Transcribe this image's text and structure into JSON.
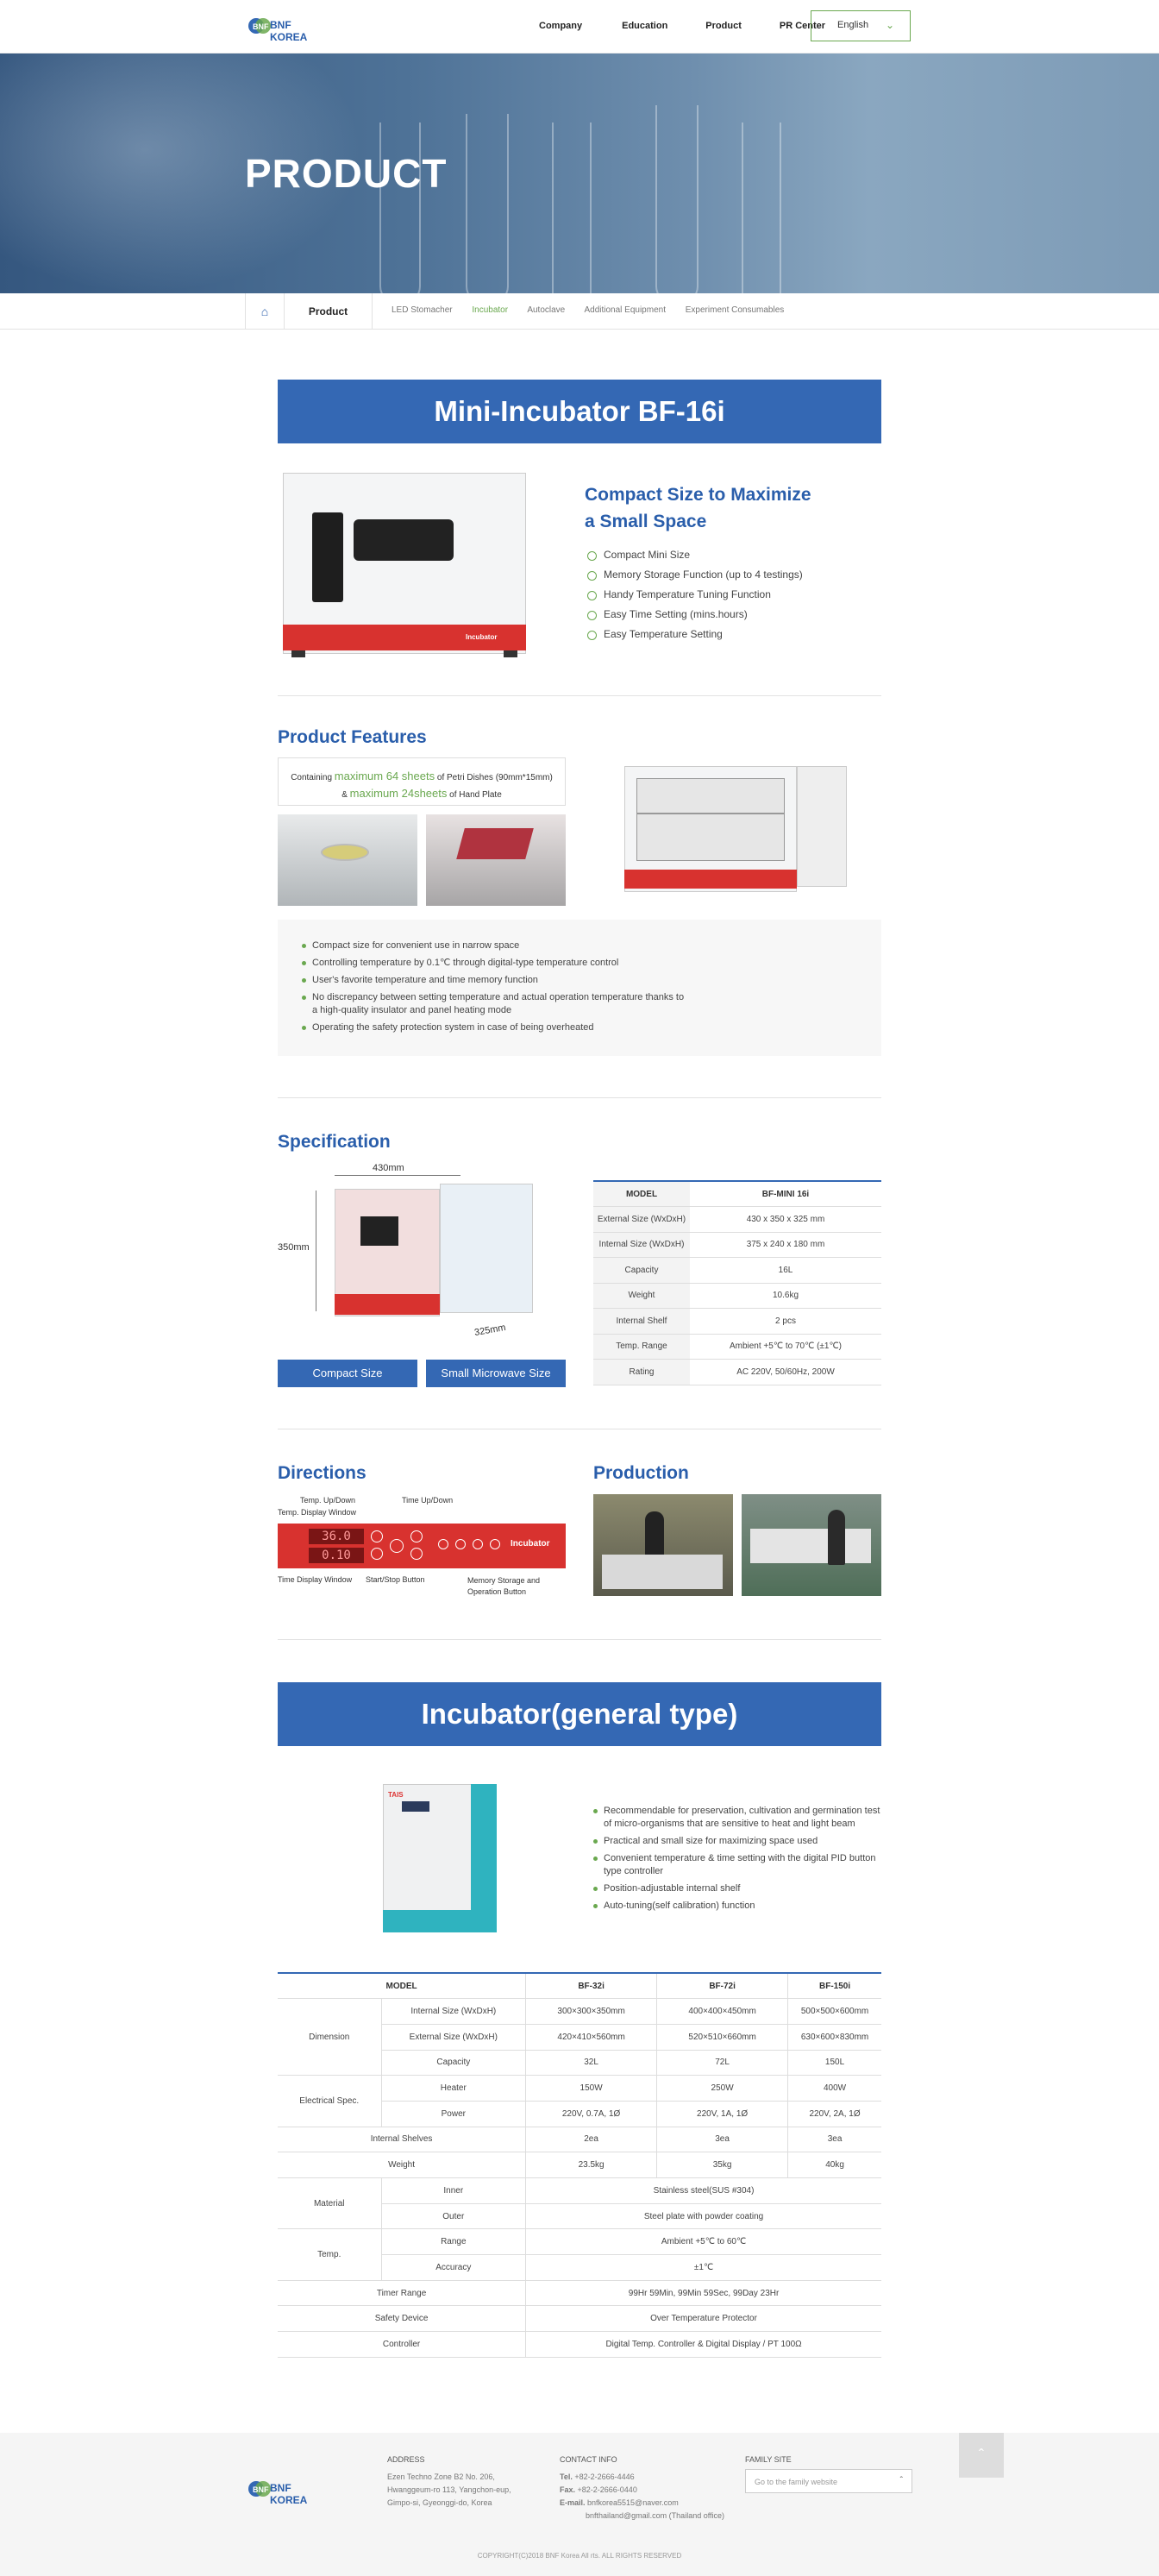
{
  "header": {
    "logo_text": "BNF KOREA",
    "nav": [
      "Company",
      "Education",
      "Product",
      "PR Center"
    ],
    "language": "English"
  },
  "hero": {
    "title": "PRODUCT"
  },
  "subnav": {
    "current": "Product",
    "links": [
      "LED Stomacher",
      "Incubator",
      "Autoclave",
      "Additional Equipment",
      "Experiment Consumables"
    ],
    "active": "Incubator"
  },
  "mini": {
    "title": "Mini-Incubator BF-16i",
    "headline_1": "Compact Size to Maximize",
    "headline_2": "a Small Space",
    "checks": [
      "Compact Mini Size",
      "Memory Storage Function (up to 4 testings)",
      "Handy Temperature Tuning Function",
      "Easy Time Setting (mins.hours)",
      "Easy Temperature Setting"
    ],
    "device_brand": "Incubator"
  },
  "features": {
    "title": "Product Features",
    "caption_1a": "Containing ",
    "caption_1b": "maximum 64 sheets",
    "caption_1c": " of Petri Dishes (90mm*15mm)",
    "caption_2a": "& ",
    "caption_2b": "maximum 24sheets",
    "caption_2c": " of Hand Plate",
    "bullets": [
      "Compact size for convenient use in narrow space",
      "Controlling temperature by 0.1℃ through digital-type temperature control",
      "User's favorite temperature and time memory function",
      "No discrepancy between setting temperature and actual operation temperature thanks to a high-quality insulator and panel heating mode",
      "Operating the safety protection system in case of being overheated"
    ]
  },
  "spec": {
    "title": "Specification",
    "dim_width": "430mm",
    "dim_height": "350mm",
    "dim_depth": "325mm",
    "header": [
      "MODEL",
      "BF-MINI 16i"
    ],
    "rows": [
      [
        "External Size (WxDxH)",
        "430 x 350 x 325 mm"
      ],
      [
        "Internal Size (WxDxH)",
        "375 x 240 x 180 mm"
      ],
      [
        "Capacity",
        "16L"
      ],
      [
        "Weight",
        "10.6kg"
      ],
      [
        "Internal Shelf",
        "2 pcs"
      ],
      [
        "Temp. Range",
        "Ambient +5℃ to 70℃ (±1℃)"
      ],
      [
        "Rating",
        "AC 220V, 50/60Hz, 200W"
      ]
    ],
    "btn_compact": "Compact Size",
    "btn_microwave": "Small Microwave Size"
  },
  "directions": {
    "title": "Directions",
    "labels": [
      "Temp. Up/Down",
      "Temp. Display Window",
      "Time Up/Down",
      "Time Display Window",
      "Start/Stop Button",
      "Memory Storage and Operation Button"
    ],
    "temp_display": "36.0",
    "time_display": "0.10",
    "panel_brand": "Incubator"
  },
  "production": {
    "title": "Production"
  },
  "general": {
    "title": "Incubator(general type)",
    "device_label": "TAIS",
    "bullets": [
      "Recommendable for preservation, cultivation and germination test of micro-organisms that are sensitive to heat and light beam",
      "Practical and small size for maximizing space used",
      "Convenient temperature & time setting with the digital PID button type controller",
      "Position-adjustable internal shelf",
      "Auto-tuning(self calibration) function"
    ],
    "table": {
      "models": [
        "MODEL",
        "BF-32i",
        "BF-72i",
        "BF-150i"
      ],
      "dimension": "Dimension",
      "electrical": "Electrical Spec.",
      "material": "Material",
      "temp": "Temp.",
      "internal_size": [
        "Internal Size (WxDxH)",
        "300×300×350mm",
        "400×400×450mm",
        "500×500×600mm"
      ],
      "external_size": [
        "External Size (WxDxH)",
        "420×410×560mm",
        "520×510×660mm",
        "630×600×830mm"
      ],
      "capacity": [
        "Capacity",
        "32L",
        "72L",
        "150L"
      ],
      "heater": [
        "Heater",
        "150W",
        "250W",
        "400W"
      ],
      "power": [
        "Power",
        "220V, 0.7A, 1Ø",
        "220V, 1A, 1Ø",
        "220V, 2A, 1Ø"
      ],
      "shelves": [
        "Internal Shelves",
        "2ea",
        "3ea",
        "3ea"
      ],
      "weight": [
        "Weight",
        "23.5kg",
        "35kg",
        "40kg"
      ],
      "inner": [
        "Inner",
        "Stainless steel(SUS #304)"
      ],
      "outer": [
        "Outer",
        "Steel plate with powder coating"
      ],
      "range": [
        "Range",
        "Ambient +5℃ to 60℃"
      ],
      "accuracy": [
        "Accuracy",
        "±1℃"
      ],
      "timer": [
        "Timer Range",
        "99Hr 59Min, 99Min 59Sec, 99Day 23Hr"
      ],
      "safety": [
        "Safety Device",
        "Over Temperature Protector"
      ],
      "controller": [
        "Controller",
        "Digital Temp. Controller & Digital Display / PT 100Ω"
      ]
    }
  },
  "footer": {
    "address_title": "ADDRESS",
    "address": [
      "Ezen Techno Zone B2 No. 206,",
      "Hwanggeum-ro 113, Yangchon-eup,",
      "Gimpo-si, Gyeonggi-do, Korea"
    ],
    "contact_title": "CONTACT INFO",
    "tel_label": "Tel.",
    "tel": " +82-2-2666-4446",
    "fax_label": "Fax.",
    "fax": " +82-2-2666-0440",
    "email_label": "E-mail.",
    "email_1": " bnfkorea5515@naver.com",
    "email_2": "bnfthailand@gmail.com (Thailand office)",
    "family_title": "FAMILY SITE",
    "family_placeholder": "Go to the family website",
    "copyright": "COPYRIGHT(C)2018 BNF Korea All rts. ALL RIGHTS RESERVED"
  }
}
